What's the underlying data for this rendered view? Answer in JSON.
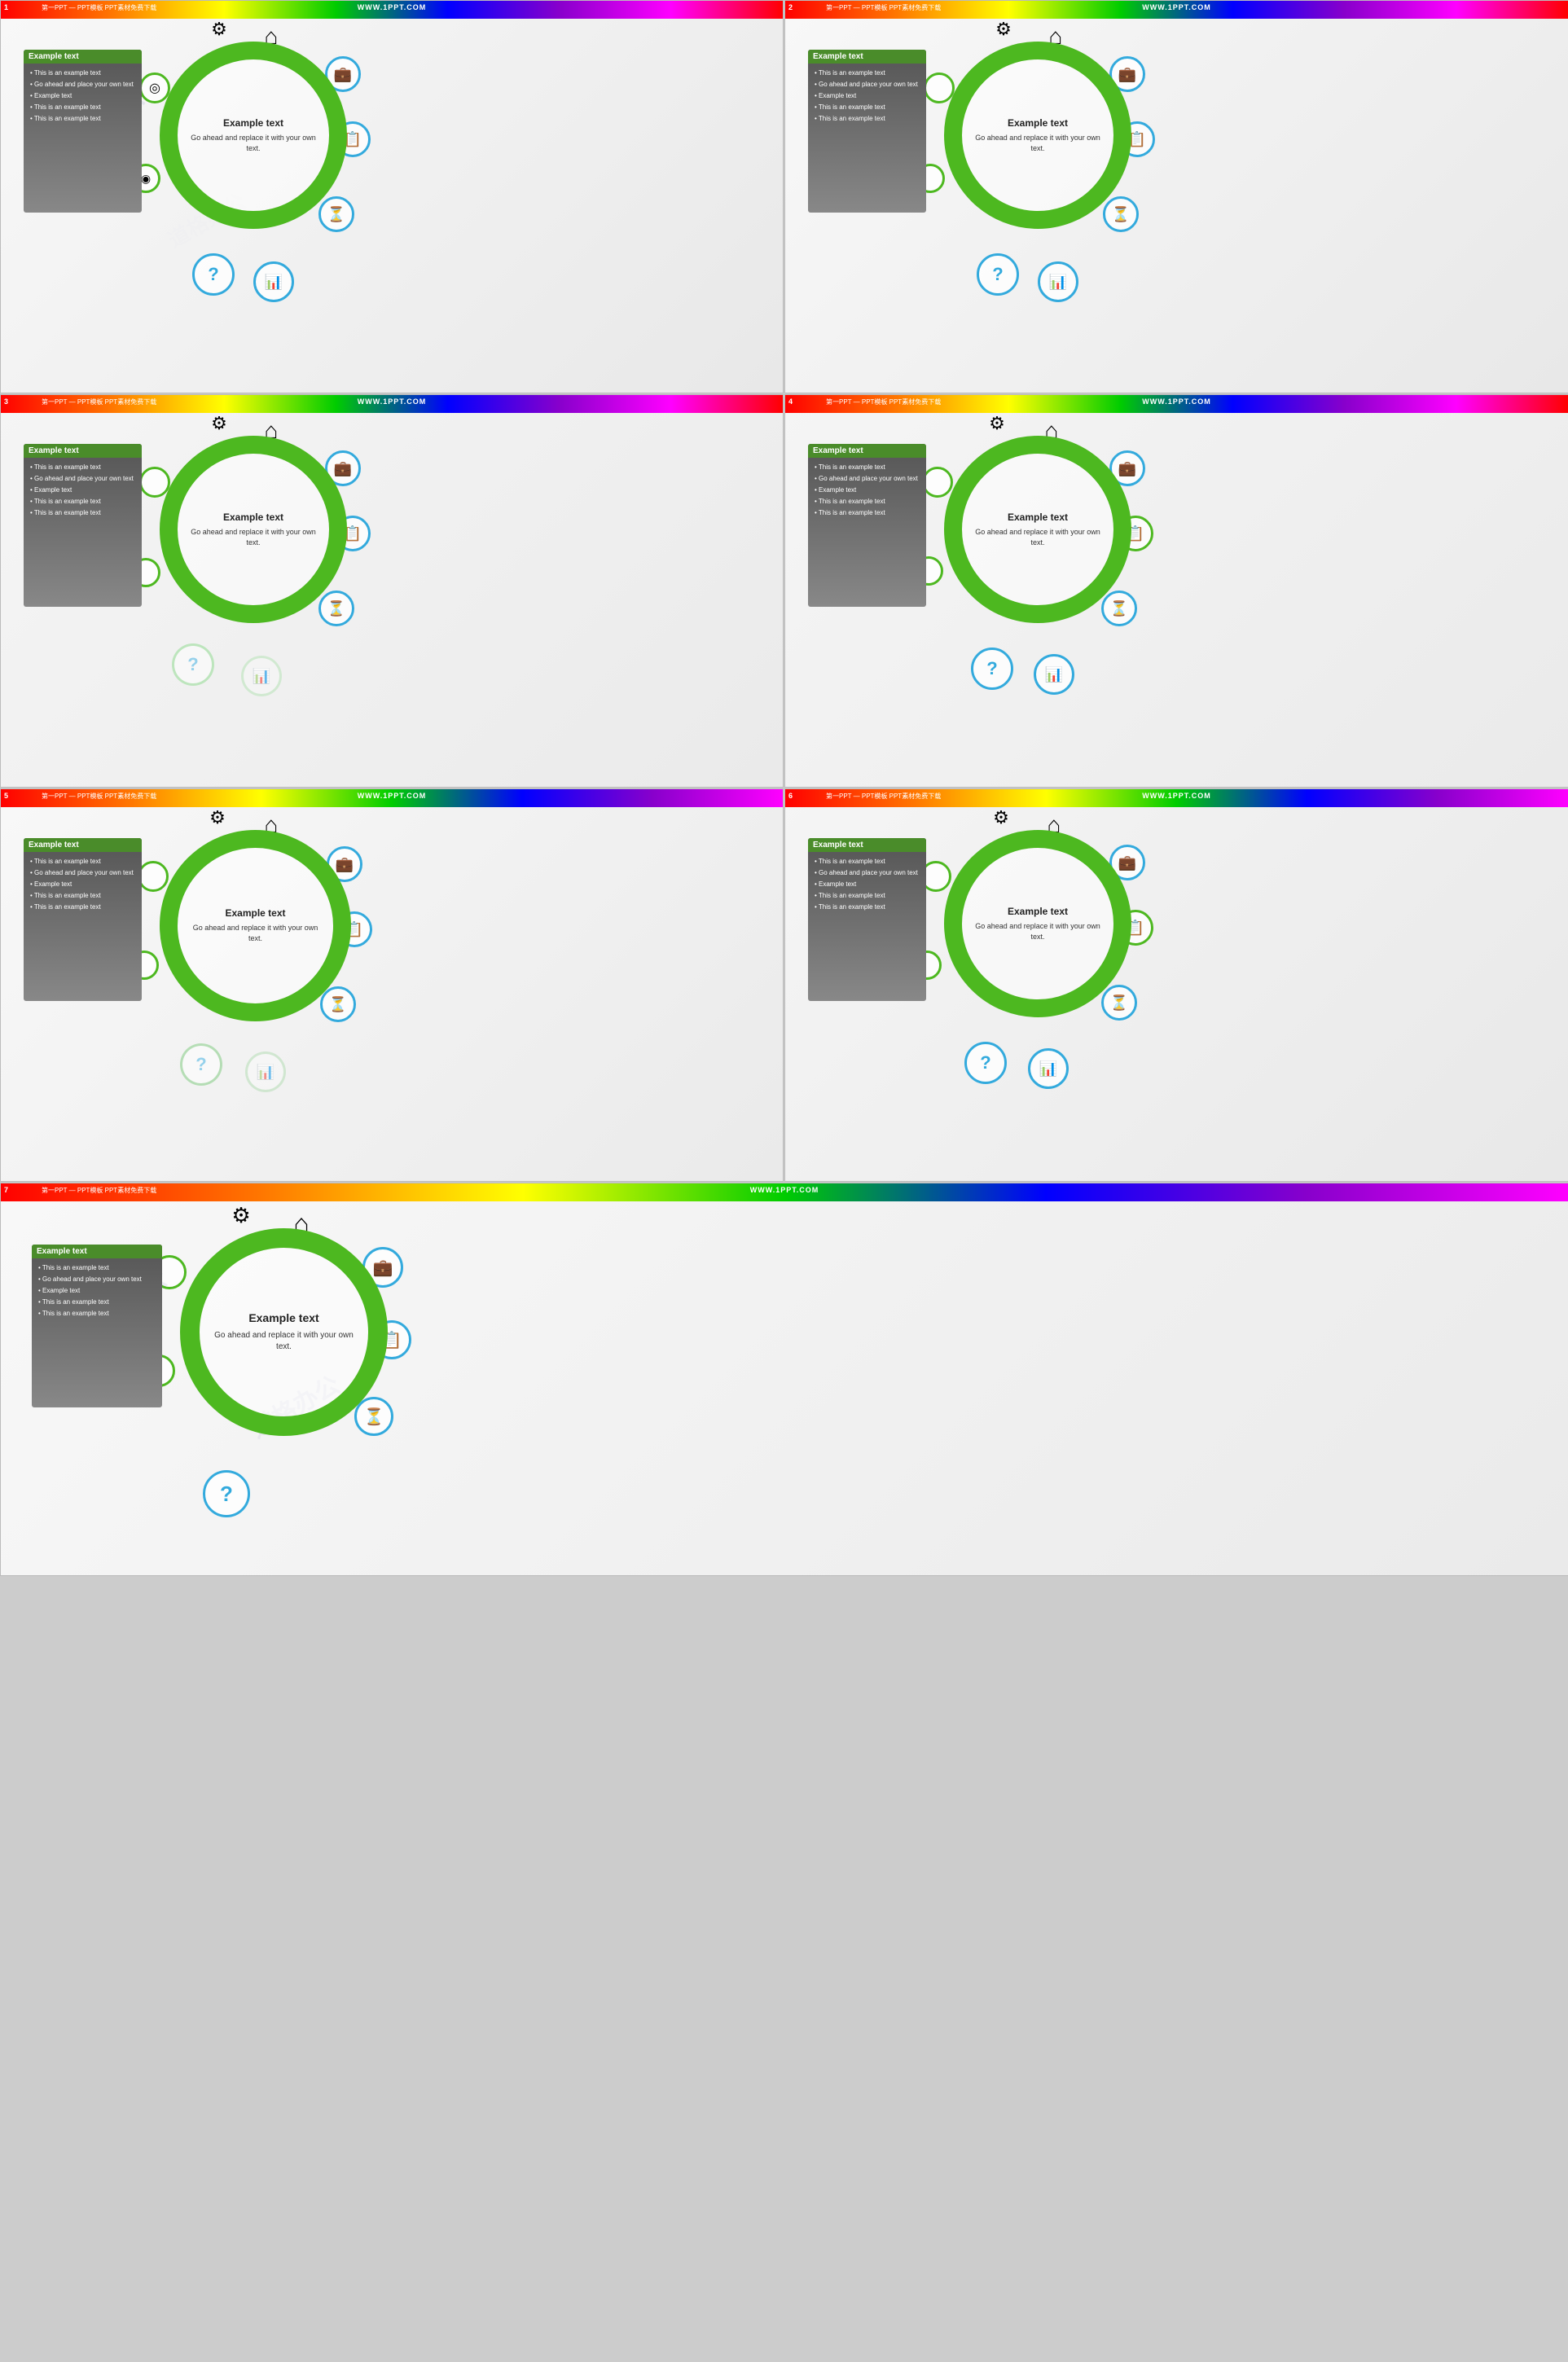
{
  "slides": [
    {
      "id": 1,
      "number": "1",
      "title": "第一PPT — PPT模板 PPT素材免费下载",
      "url": "WWW.1PPT.COM",
      "panel": {
        "title": "Example text",
        "bullets": [
          "• This is an example text",
          "• Go ahead and place your own text",
          "• Example text",
          "• This is an example text",
          "• This is an example text"
        ]
      },
      "main_title": "Example text",
      "main_body": "Go ahead and replace it with your own text."
    },
    {
      "id": 2,
      "number": "2",
      "title": "第一PPT — PPT模板 PPT素材免费下载",
      "url": "WWW.1PPT.COM",
      "panel": {
        "title": "Example text",
        "bullets": [
          "• This is an example text",
          "• Go ahead and place your own text",
          "• Example text",
          "• This is an example text",
          "• This is an example text"
        ]
      },
      "main_title": "Example text",
      "main_body": "Go ahead and replace it with your own text."
    },
    {
      "id": 3,
      "number": "3",
      "title": "第一PPT — PPT模板 PPT素材免费下载",
      "url": "WWW.1PPT.COM",
      "panel": {
        "title": "Example text",
        "bullets": [
          "• This is an example text",
          "• Go ahead and place your own text",
          "• Example text",
          "• This is an example text",
          "• This is an example text"
        ]
      },
      "main_title": "Example text",
      "main_body": "Go ahead and replace it with your own text."
    },
    {
      "id": 4,
      "number": "4",
      "title": "第一PPT — PPT模板 PPT素材免费下载",
      "url": "WWW.1PPT.COM",
      "panel": {
        "title": "Example text",
        "bullets": [
          "• This is an example text",
          "• Go ahead and place your own text",
          "• Example text",
          "• This is an example text",
          "• This is an example text"
        ]
      },
      "main_title": "Example text",
      "main_body": "Go ahead and replace it with your own text."
    },
    {
      "id": 5,
      "number": "5",
      "title": "第一PPT — PPT模板 PPT素材免费下载",
      "url": "WWW.1PPT.COM",
      "panel": {
        "title": "Example text",
        "bullets": [
          "• This is an example text",
          "• Go ahead and place your own text",
          "• Example text",
          "• This is an example text",
          "• This is an example text"
        ]
      },
      "main_title": "Example text",
      "main_body": "Go ahead and replace it with your own text."
    },
    {
      "id": 6,
      "number": "6",
      "title": "第一PPT — PPT模板 PPT素材免费下载",
      "url": "WWW.1PPT.COM",
      "panel": {
        "title": "Example text",
        "bullets": [
          "• This is an example text",
          "• Go ahead and place your own text",
          "• Example text",
          "• This is an example text",
          "• This is an example text"
        ]
      },
      "main_title": "Example text",
      "main_body": "Go ahead and replace it with your own text."
    },
    {
      "id": 7,
      "number": "7",
      "title": "第一PPT — PPT模板 PPT素材免费下载",
      "url": "WWW.1PPT.COM",
      "panel": {
        "title": "Example text",
        "bullets": [
          "• This is an example text",
          "• Go ahead and place your own text",
          "• Example text",
          "• This is an example text",
          "• This is an example text"
        ]
      },
      "main_title": "Example text",
      "main_body": "Go ahead and replace it with your own text."
    }
  ],
  "watermark": "道格办公",
  "colors": {
    "green": "#4db820",
    "blue": "#33aadd",
    "dark": "#444",
    "rainbow_start": "#ff0000",
    "rainbow_end": "#ff00ff"
  }
}
